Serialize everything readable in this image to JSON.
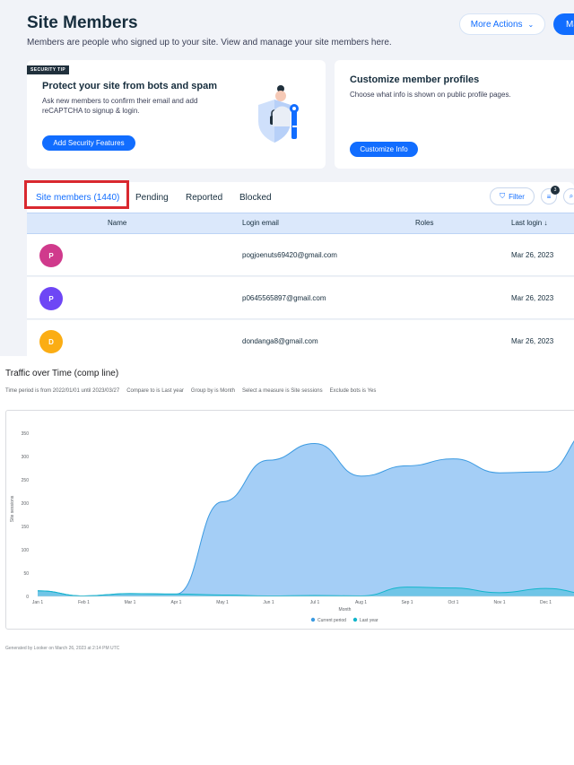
{
  "members_page": {
    "title": "Site Members",
    "subtitle": "Members are people who signed up to your site. View and manage your site members here.",
    "more_actions_label": "More Actions",
    "add_member_label": "Ma",
    "security_card": {
      "badge": "SECURITY TIP",
      "title": "Protect your site from bots and spam",
      "description": "Ask new members to confirm their email and add reCAPTCHA to signup & login.",
      "button_label": "Add Security Features"
    },
    "profile_card": {
      "title": "Customize member profiles",
      "description": "Choose what info is shown on public profile pages.",
      "button_label": "Customize Info"
    },
    "tabs": [
      {
        "label": "Site members (1440)",
        "active": true
      },
      {
        "label": "Pending",
        "active": false
      },
      {
        "label": "Reported",
        "active": false
      },
      {
        "label": "Blocked",
        "active": false
      }
    ],
    "filter_label": "Filter",
    "columns_count": "3",
    "table": {
      "headers": [
        "Name",
        "Login email",
        "Roles",
        "Last login ↓"
      ],
      "rows": [
        {
          "initial": "P",
          "color": "#d03a8c",
          "email": "pogjoenuts69420@gmail.com",
          "last_login": "Mar 26, 2023"
        },
        {
          "initial": "P",
          "color": "#6e46f5",
          "email": "p0645565897@gmail.com",
          "last_login": "Mar 26, 2023"
        },
        {
          "initial": "D",
          "color": "#fbad14",
          "email": "dondanga8@gmail.com",
          "last_login": "Mar 26, 2023"
        }
      ]
    }
  },
  "report": {
    "title": "Traffic over Time (comp line)",
    "params": [
      "Time period is from 2022/01/01 until 2023/03/27",
      "Compare to is Last year",
      "Group by is Month",
      "Select a measure is Site sessions",
      "Exclude bots is Yes"
    ],
    "footer": "Generated by Looker on March 26, 2023 at 2:14 PM UTC"
  },
  "chart_data": {
    "type": "area",
    "title": "",
    "xlabel": "Month",
    "ylabel": "Site sessions",
    "ylim": [
      0,
      375
    ],
    "yticks": [
      0,
      50,
      100,
      150,
      200,
      250,
      300,
      350
    ],
    "categories": [
      "Jan 1",
      "Feb 1",
      "Mar 1",
      "Apr 1",
      "May 1",
      "Jun 1",
      "Jul 1",
      "Aug 1",
      "Sep 1",
      "Oct 1",
      "Nov 1",
      "Dec 1"
    ],
    "series": [
      {
        "name": "Current period",
        "color": "#9fcbf5",
        "stroke": "#3b9ae1",
        "values": [
          12,
          1,
          6,
          5,
          203,
          292,
          328,
          258,
          280,
          295,
          265,
          267,
          360
        ]
      },
      {
        "name": "Last year",
        "color": "#12b5cb",
        "stroke": "#12b5cb",
        "values": [
          12,
          1,
          6,
          5,
          3,
          1,
          2,
          1,
          20,
          18,
          8,
          17,
          5
        ]
      }
    ],
    "legend_position": "bottom",
    "grid": false
  }
}
